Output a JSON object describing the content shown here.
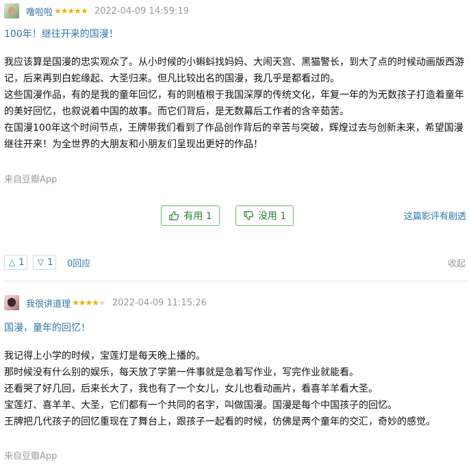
{
  "reviews": [
    {
      "username": "噜啦啦",
      "rating": 5,
      "stars_on": "★★★★★",
      "stars_off": "",
      "time": "2022-04-09 14:59:19",
      "title": "100年！继往开来的国漫！",
      "paragraphs": [
        "我应该算是国漫的忠实观众了。从小时候的小蝌蚪找妈妈、大闹天宫、黑猫警长，到大了点的时候动画版西游",
        "记，后来再到白蛇缘起、大圣归来。但凡比较出名的国漫，我几乎是都看过的。",
        "这些国漫作品，有的是我的童年回忆，有的则植根于我国深厚的传统文化，年复一年的为无数孩子打造着童年",
        "的美好回忆，也叙说着中国的故事。而它们背后，是无数幕后工作者的含辛茹苦。",
        "在国漫100年这个时间节点，王牌带我们看到了作品创作背后的辛苦与突破，辉煌过去与创新未来，希望国漫",
        "继往开来！为全世界的大朋友和小朋友们呈现出更好的作品！"
      ],
      "source": "来自豆瓣App",
      "useful_label": "有用 1",
      "useless_label": "没用 1",
      "share_label": "这篇影评有剧透",
      "upvote_count": "1",
      "downvote_count": "1",
      "reply_label": "0回应",
      "collapse_label": "收起"
    },
    {
      "username": "我很讲道理",
      "rating": 4,
      "stars_on": "★★★★",
      "stars_off": "★",
      "time": "2022-04-09 11:15:26",
      "title": "国漫，童年的回忆！",
      "paragraphs": [
        "我记得上小学的时候，宝莲灯是每天晚上播的。",
        "那时候没有什么别的娱乐，每天放了学第一件事就是急着写作业，写完作业就能看。",
        "还看哭了好几回，后来长大了，我也有了一个女儿，女儿也看动画片，看喜羊羊看大圣。",
        "宝莲灯、喜羊羊、大圣，它们都有一个共同的名字，叫做国漫。国漫是每个中国孩子的回忆。",
        "王牌把几代孩子的回忆重现在了舞台上，跟孩子一起看的时候，仿佛是两个童年的交汇，奇妙的感觉。"
      ],
      "source": "来自豆瓣App"
    }
  ],
  "icons": {
    "useful": "thumb-up-icon",
    "useless": "thumb-down-icon",
    "upvote": "triangle-up-icon",
    "downvote": "triangle-down-icon"
  },
  "colors": {
    "link": "#3377aa",
    "star": "#f6ab00",
    "button_border": "#6bb86f",
    "muted": "#999999"
  }
}
